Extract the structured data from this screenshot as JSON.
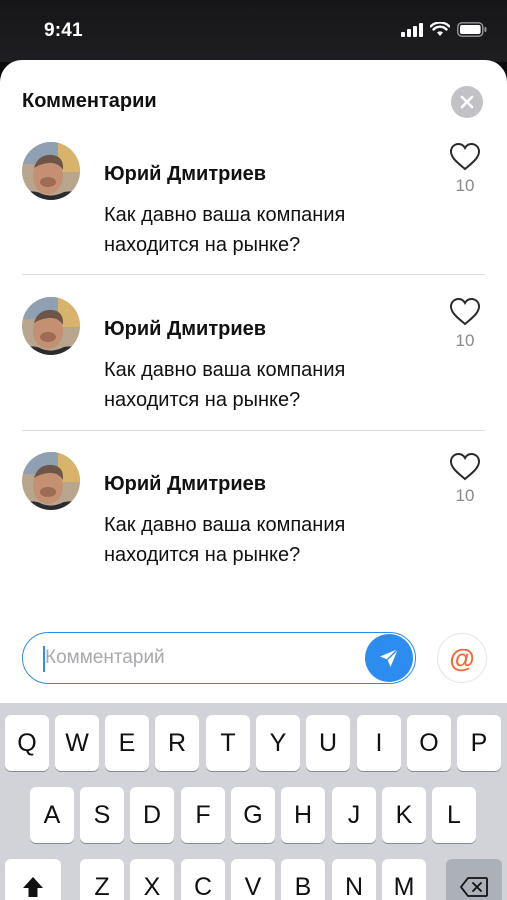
{
  "status_bar": {
    "time": "9:41"
  },
  "sheet": {
    "title": "Комментарии",
    "comments": [
      {
        "author": "Юрий Дмитриев",
        "text": "Как давно ваша компания находится на рынке?",
        "likes": "10"
      },
      {
        "author": "Юрий Дмитриев",
        "text": "Как давно ваша компания находится на рынке?",
        "likes": "10"
      },
      {
        "author": "Юрий Дмитриев",
        "text": "Как давно ваша компания находится на рынке?",
        "likes": "10"
      }
    ]
  },
  "composer": {
    "placeholder": "Комментарий",
    "value": "",
    "mention_symbol": "@"
  },
  "keyboard": {
    "row1": [
      "Q",
      "W",
      "E",
      "R",
      "T",
      "Y",
      "U",
      "I",
      "O",
      "P"
    ],
    "row2": [
      "A",
      "S",
      "D",
      "F",
      "G",
      "H",
      "J",
      "K",
      "L"
    ],
    "row3": [
      "Z",
      "X",
      "C",
      "V",
      "B",
      "N",
      "M"
    ]
  },
  "colors": {
    "accent": "#2d8cf0",
    "mention": "#f26b3a",
    "close_bg": "#c2c2c6",
    "keyboard_bg": "#d1d3d9"
  },
  "icons": [
    "signal-icon",
    "wifi-icon",
    "battery-icon",
    "close-icon",
    "heart-icon",
    "send-icon",
    "at-icon",
    "shift-icon",
    "backspace-icon"
  ]
}
